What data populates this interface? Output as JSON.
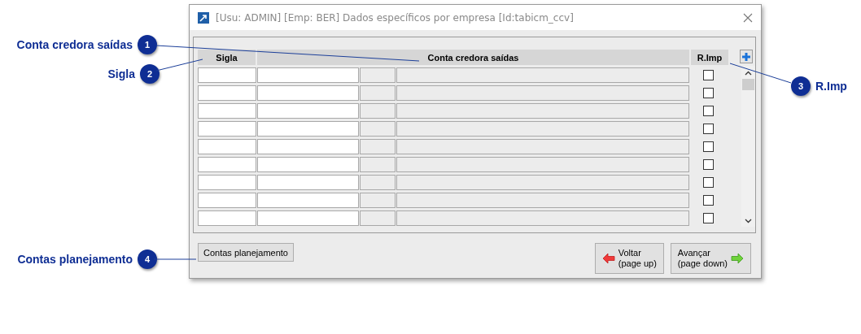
{
  "window": {
    "title": "[Usu: ADMIN] [Emp: BER] Dados específicos por empresa [Id:tabicm_ccv]"
  },
  "table": {
    "columns": [
      "Sigla",
      "Conta credora saídas",
      "R.Imp"
    ],
    "rows": [
      {
        "checked": false
      },
      {
        "checked": false
      },
      {
        "checked": false
      },
      {
        "checked": false
      },
      {
        "checked": false
      },
      {
        "checked": false
      },
      {
        "checked": false
      },
      {
        "checked": false
      },
      {
        "checked": false
      }
    ]
  },
  "buttons": [
    {
      "kind": "plain",
      "label": "Contas planejamento"
    },
    {
      "kind": "back",
      "label": "Voltar",
      "sublabel": "(page up)"
    },
    {
      "kind": "next",
      "label": "Avançar",
      "sublabel": "(page down)"
    }
  ],
  "callouts": [
    {
      "number": "1",
      "label": "Conta credora saídas"
    },
    {
      "number": "2",
      "label": "Sigla"
    },
    {
      "number": "3",
      "label": "R.Imp"
    },
    {
      "number": "4",
      "label": "Contas planejamento"
    }
  ]
}
